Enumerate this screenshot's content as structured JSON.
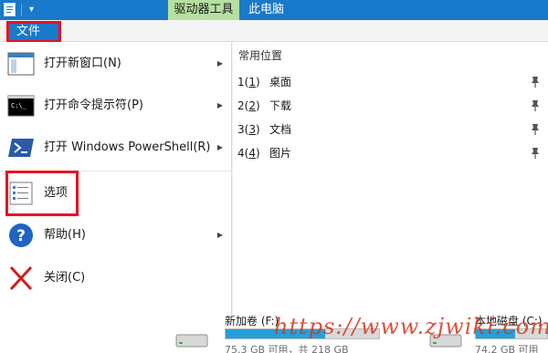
{
  "titlebar": {
    "qat_dropdown": "▾",
    "context_tab": "驱动器工具",
    "window_title": "此电脑",
    "color": "#1979ca"
  },
  "menu": {
    "file_tab": "文件"
  },
  "left_menu": [
    {
      "label": "打开新窗口(N)",
      "icon": "new-window-icon",
      "submenu": true
    },
    {
      "label": "打开命令提示符(P)",
      "icon": "command-prompt-icon",
      "submenu": true
    },
    {
      "label": "打开 Windows PowerShell(R)",
      "icon": "powershell-icon",
      "submenu": true
    },
    {
      "label": "选项",
      "icon": "options-icon",
      "submenu": false
    },
    {
      "label": "帮助(H)",
      "icon": "help-icon",
      "submenu": true
    },
    {
      "label": "关闭(C)",
      "icon": "close-icon",
      "submenu": false
    }
  ],
  "recent": {
    "heading": "常用位置",
    "items": [
      {
        "num": "1",
        "key": "1",
        "name": "桌面"
      },
      {
        "num": "2",
        "key": "2",
        "name": "下载"
      },
      {
        "num": "3",
        "key": "3",
        "name": "文档"
      },
      {
        "num": "4",
        "key": "4",
        "name": "图片"
      }
    ]
  },
  "drives": [
    {
      "name": "新加卷 (F:)",
      "sub": "75.3 GB 可用，共 218 GB",
      "used_fraction": 0.65
    },
    {
      "name": "本地磁盘 (C:)",
      "sub": "74.2 GB 可用",
      "used_fraction": 0.55
    }
  ],
  "watermark": "https://www.zjwiki.com"
}
